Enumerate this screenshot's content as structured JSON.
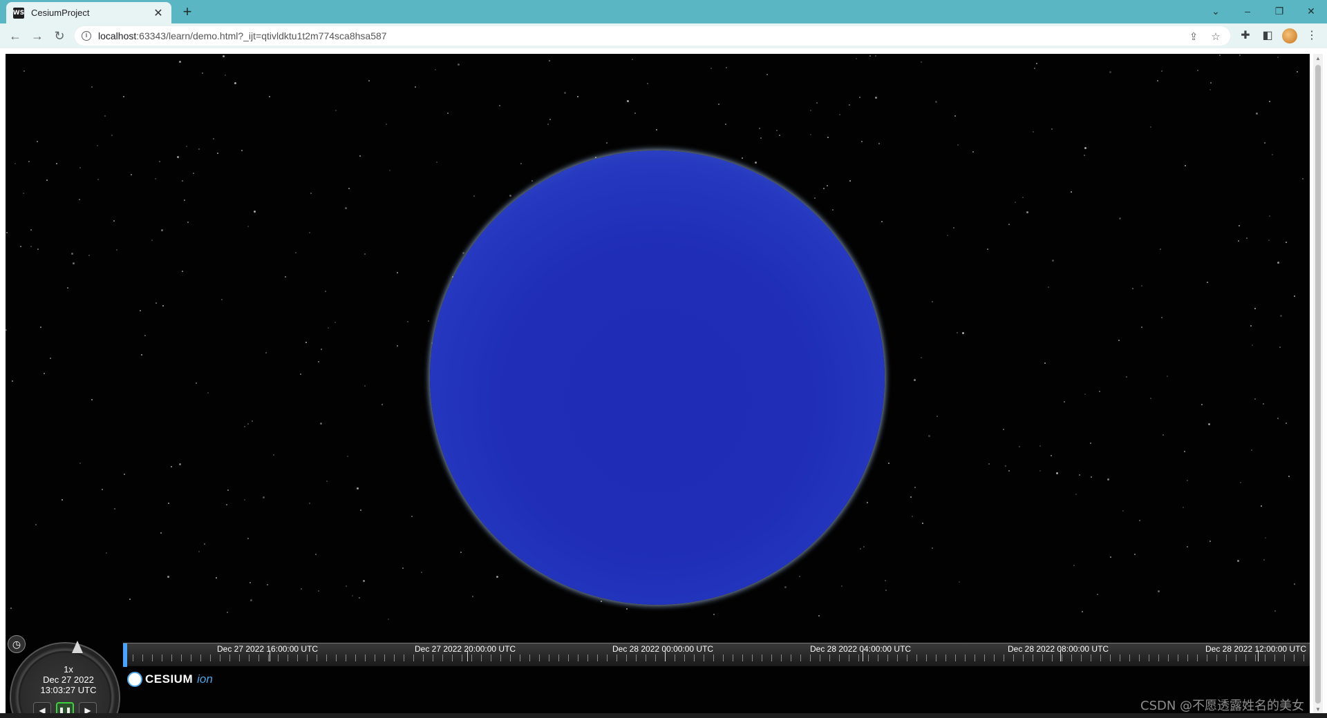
{
  "browser": {
    "tab_title": "CesiumProject",
    "tab_favicon": "WS",
    "close_symbol": "✕",
    "new_tab_symbol": "+",
    "url_host": "localhost",
    "url_rest": ":63343/learn/demo.html?_ijt=qtivldktu1t2m774sca8hsa587"
  },
  "icons": {
    "back": "arrow-left-icon",
    "forward": "arrow-right-icon",
    "reload": "reload-icon",
    "info": "info-icon",
    "share": "share-icon",
    "star": "star-icon",
    "extensions": "puzzle-icon",
    "sidepanel": "side-panel-icon",
    "menu": "kebab-menu-icon"
  },
  "animation": {
    "speed": "1x",
    "date": "Dec 27 2022",
    "time": "13:03:27 UTC"
  },
  "logo": {
    "name": "CESIUM",
    "suffix": "ion"
  },
  "timeline": {
    "labels": [
      "Dec 27 2022 16:00:00 UTC",
      "Dec 27 2022 20:00:00 UTC",
      "Dec 28 2022 00:00:00 UTC",
      "Dec 28 2022 04:00:00 UTC",
      "Dec 28 2022 08:00:00 UTC",
      "Dec 28 2022 12:00:00 UTC"
    ]
  },
  "watermark": "CSDN @不愿透露姓名的美女",
  "colors": {
    "globe": "#1f2db7",
    "background": "#020202",
    "accent": "#4da4e6"
  }
}
